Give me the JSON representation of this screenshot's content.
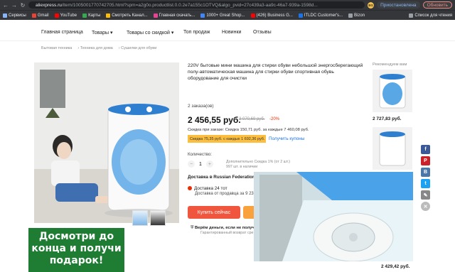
{
  "browser": {
    "url_prefix": "aliexpress.ru",
    "url_rest": "/item/1005001770742705.html?spm=a2g0o.productlist.0.0.2e7a155c1OTVQ&algo_pvid=27c439a3-aa9c-46a7-939a-1598d...",
    "paused_label": "Приостановлена",
    "update_label": "Обновить",
    "avatar_initials": "BG"
  },
  "bookmarks": [
    {
      "label": "Сервисы",
      "color": "#8ab4f8"
    },
    {
      "label": "Gmail",
      "color": "#ea4335"
    },
    {
      "label": "YouTube",
      "color": "#ff0000"
    },
    {
      "label": "Карты",
      "color": "#34a853"
    },
    {
      "label": "Смотреть Канал...",
      "color": "#fbbc04"
    },
    {
      "label": "Главная скачать...",
      "color": "#e84393"
    },
    {
      "label": "1000+ Great Shop...",
      "color": "#4285f4"
    },
    {
      "label": "(426) Business G...",
      "color": "#ff0000"
    },
    {
      "label": "ITLDC Customer's...",
      "color": "#1a73e8"
    },
    {
      "label": "Bizon",
      "color": "#9aa0a6"
    },
    {
      "label": "Список для чтения",
      "color": "#9aa0a6"
    }
  ],
  "topnav": [
    "Главная страница",
    "Товары ▾",
    "Товары со скидкой ▾",
    "Топ продаж",
    "Новинки",
    "Отзывы"
  ],
  "breadcrumbs": [
    "Бытовая техника",
    "Техника для дома",
    "Сушилки для обуви"
  ],
  "product": {
    "title": "220V бытовые мини машина для стирки обуви небольшой энергосберегающий полу-автоматическая машина для стирки обуви спортивная обувь оборудование для очистки",
    "orders": "2 заказа(ов)",
    "price": "2 456,55 руб.",
    "old_price": "3 070,69 руб.",
    "discount": "-20%",
    "order_discount": "Скидка при заказе: Скидка 150,71 руб. за каждые 7 460,08 руб.",
    "coupon_bar": "Скидка 75,35 руб. с каждых 1 692,36 руб.",
    "coupon_link": "Получить купоны",
    "qty_label": "Количество:",
    "qty_value": "1",
    "qty_note_1": "Дополнительно Скидка 1% (от 2 шт.)",
    "qty_note_2": "997 шт. в наличии",
    "shipping": "Доставка в Russian Federation ▾",
    "delivery_price": "Доставка 24 тот",
    "delivery_sub": "Доставка от продавца за 9 23",
    "buy_label": "Купить сейчас",
    "guarantee": "Верём деньги, если не получ",
    "guarantee_sub": "Гарантированный возврат сре"
  },
  "recommend": {
    "label": "Рекомендуем вам",
    "prices": [
      "2 727,83 руб.",
      "2 429,42 руб."
    ]
  },
  "promo_text": "Досмотри до конца и получи подарок!",
  "colors": {
    "accent_red": "#f0563d",
    "promo_green": "#1f7d33",
    "coupon_yellow": "#fcbe3e"
  }
}
